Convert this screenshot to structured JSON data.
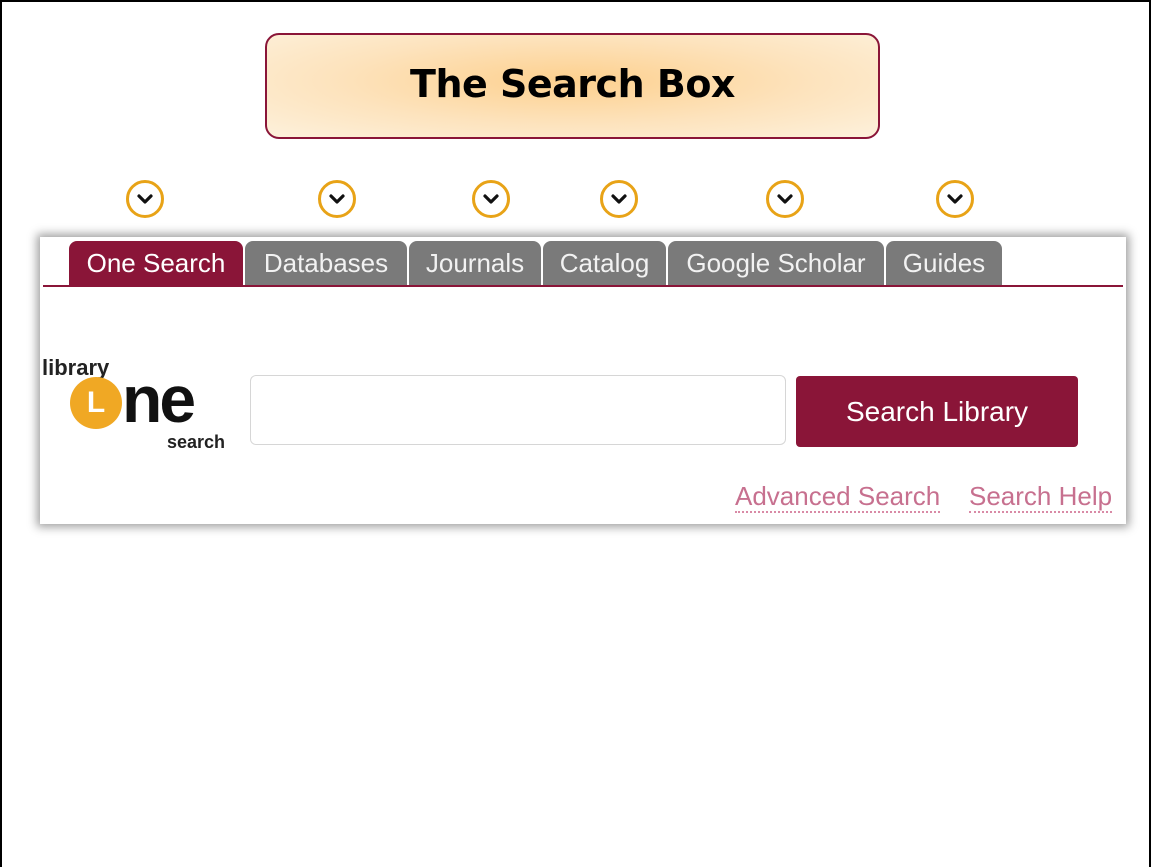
{
  "title": "The Search Box",
  "markers": [
    {
      "icon": "chevron-down-icon"
    },
    {
      "icon": "chevron-down-icon"
    },
    {
      "icon": "chevron-down-icon"
    },
    {
      "icon": "chevron-down-icon"
    },
    {
      "icon": "chevron-down-icon"
    },
    {
      "icon": "chevron-down-icon"
    }
  ],
  "tabs": [
    {
      "label": "One Search",
      "active": true
    },
    {
      "label": "Databases",
      "active": false
    },
    {
      "label": "Journals",
      "active": false
    },
    {
      "label": "Catalog",
      "active": false
    },
    {
      "label": "Google Scholar",
      "active": false
    },
    {
      "label": "Guides",
      "active": false
    }
  ],
  "logo": {
    "top": "library",
    "mark_letter": "L",
    "main": "ne",
    "bottom": "search"
  },
  "search": {
    "value": "",
    "placeholder": "",
    "button_label": "Search Library"
  },
  "links": {
    "advanced": "Advanced Search",
    "help": "Search Help"
  },
  "colors": {
    "brand": "#8a1538",
    "tab_inactive": "#7a7a7a",
    "marker": "#e8a317",
    "logo_orange": "#f0a824",
    "link": "#c7708f"
  }
}
